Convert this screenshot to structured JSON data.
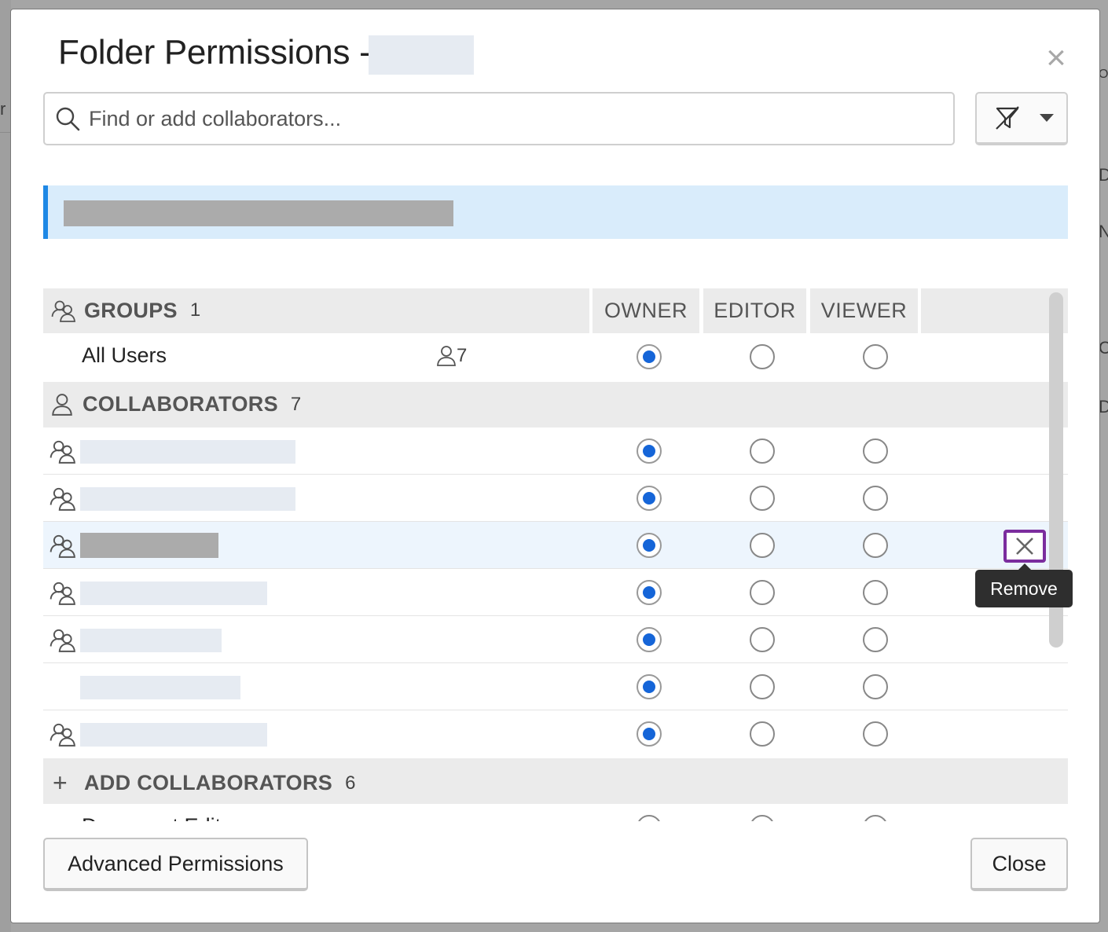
{
  "background": {
    "frag_left": "r",
    "frag_right": [
      "D",
      "N",
      "C",
      "D",
      "Op"
    ]
  },
  "dialog": {
    "title": "Folder Permissions -",
    "close_glyph": "×"
  },
  "search": {
    "placeholder": "Find or add collaborators..."
  },
  "filter": {
    "icon": "filter-off-icon",
    "dropdown_icon": "caret-down-icon"
  },
  "table": {
    "columns": [
      "OWNER",
      "EDITOR",
      "VIEWER"
    ],
    "groups_section": {
      "label": "GROUPS",
      "count": "1"
    },
    "groups": [
      {
        "name": "All Users",
        "member_count": "7",
        "role": "owner"
      }
    ],
    "collaborators_section": {
      "label": "COLLABORATORS",
      "count": "7"
    },
    "collaborators": [
      {
        "role": "owner",
        "has_icon": true
      },
      {
        "role": "owner",
        "has_icon": true
      },
      {
        "role": "owner",
        "has_icon": true,
        "highlighted": true
      },
      {
        "role": "owner",
        "has_icon": true
      },
      {
        "role": "owner",
        "has_icon": true
      },
      {
        "role": "owner",
        "has_icon": false
      },
      {
        "role": "owner",
        "has_icon": true
      }
    ],
    "add_section": {
      "glyph": "+",
      "label": "ADD COLLABORATORS",
      "count": "6"
    },
    "partial_row_text": "Document Edit"
  },
  "tooltip": {
    "text": "Remove"
  },
  "footer": {
    "advanced_label": "Advanced Permissions",
    "close_label": "Close"
  },
  "colors": {
    "accent": "#1e88e5",
    "radio_selected": "#1565d8",
    "banner_bg": "#d9ecfb",
    "focus_outline": "#7b2d9e"
  }
}
